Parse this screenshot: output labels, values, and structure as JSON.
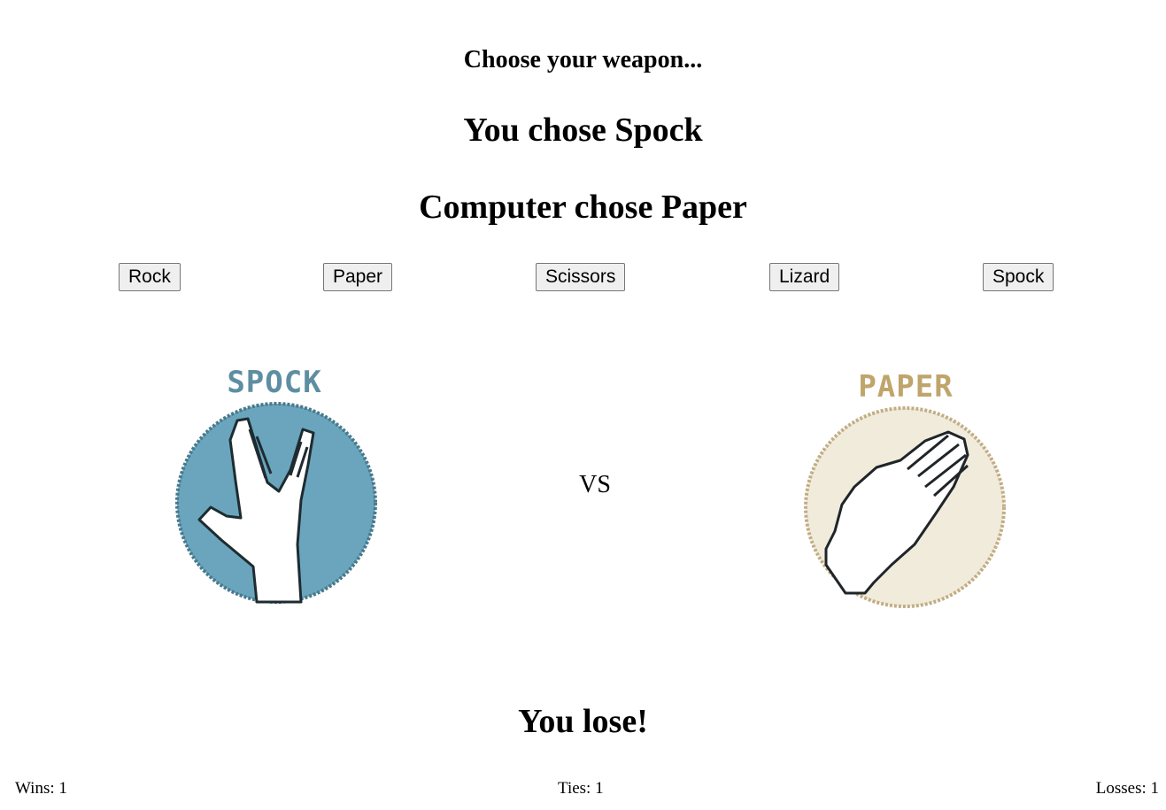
{
  "prompt": "Choose your weapon...",
  "player": {
    "label": "You chose Spock",
    "badge_text": "SPOCK",
    "badge_color": "#6aa5bd"
  },
  "computer": {
    "label": "Computer chose Paper",
    "badge_text": "PAPER",
    "badge_color": "#f1ebdc",
    "badge_outline": "#c2ad84"
  },
  "weapons": [
    "Rock",
    "Paper",
    "Scissors",
    "Lizard",
    "Spock"
  ],
  "vs": "VS",
  "result": "You lose!",
  "score": {
    "wins": "Wins: 1",
    "ties": "Ties: 1",
    "losses": "Losses: 1"
  }
}
